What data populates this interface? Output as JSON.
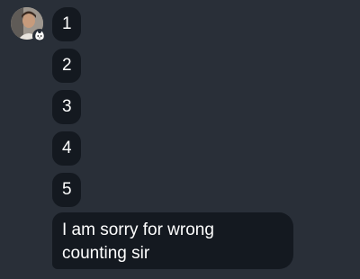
{
  "avatar": {
    "icon": "user-avatar-photo",
    "badge_icon": "cat-sticker-icon"
  },
  "messages": [
    {
      "text": "1"
    },
    {
      "text": "2"
    },
    {
      "text": "3"
    },
    {
      "text": "4"
    },
    {
      "text": "5"
    },
    {
      "text": "I am sorry for wrong counting sir"
    }
  ],
  "colors": {
    "background": "#292f38",
    "bubble": "#141920",
    "text": "#ffffff"
  }
}
